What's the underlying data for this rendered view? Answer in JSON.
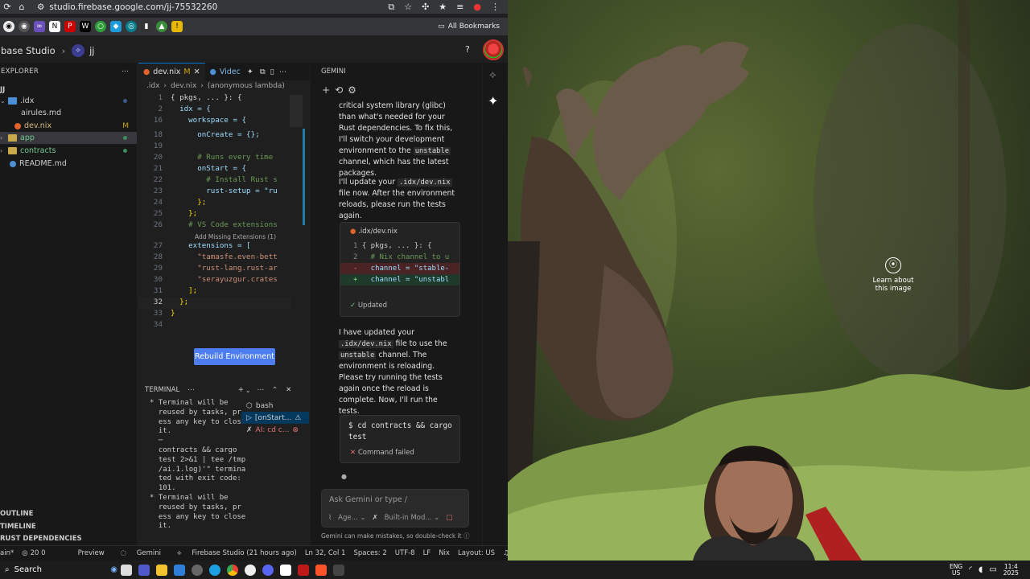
{
  "browser": {
    "url": "studio.firebase.google.com/jj-75532260",
    "all_bookmarks": "All Bookmarks"
  },
  "studio": {
    "brand": "base Studio",
    "project": "jj"
  },
  "explorer": {
    "title": "EXPLORER",
    "root": "JJ",
    "items": [
      {
        "label": ".idx",
        "kind": "folder-open"
      },
      {
        "label": "airules.md",
        "kind": "file"
      },
      {
        "label": "dev.nix",
        "kind": "file",
        "mark": "M"
      },
      {
        "label": "app",
        "kind": "folder"
      },
      {
        "label": "contracts",
        "kind": "folder"
      },
      {
        "label": "README.md",
        "kind": "file"
      }
    ],
    "sections": [
      "OUTLINE",
      "TIMELINE",
      "RUST DEPENDENCIES"
    ]
  },
  "editor": {
    "tabs": [
      {
        "label": "dev.nix",
        "mark": "M"
      },
      {
        "label": "Videc"
      }
    ],
    "breadcrumb": [
      ".idx",
      "dev.nix",
      "(anonymous lambda)"
    ],
    "lines": [
      {
        "n": "1",
        "text": "{ pkgs, ... }: {"
      },
      {
        "n": "2",
        "text": "  idx = {"
      },
      {
        "n": "16",
        "text": "    workspace = {"
      },
      {
        "n": "18",
        "text": "      onCreate = {};"
      },
      {
        "n": "19",
        "text": ""
      },
      {
        "n": "20",
        "text": "      # Runs every time"
      },
      {
        "n": "21",
        "text": "      onStart = {"
      },
      {
        "n": "22",
        "text": "        # Install Rust s"
      },
      {
        "n": "23",
        "text": "        rust-setup = \"ru"
      },
      {
        "n": "24",
        "text": "      };"
      },
      {
        "n": "25",
        "text": "    };"
      },
      {
        "n": "26",
        "text": "    # VS Code extensions"
      },
      {
        "n": "27",
        "text": "    extensions = ["
      },
      {
        "n": "28",
        "text": "      \"tamasfe.even-bett"
      },
      {
        "n": "29",
        "text": "      \"rust-lang.rust-ar"
      },
      {
        "n": "30",
        "text": "      \"serayuzgur.crates"
      },
      {
        "n": "31",
        "text": "    ];"
      },
      {
        "n": "32",
        "text": "  };"
      },
      {
        "n": "33",
        "text": "}"
      },
      {
        "n": "34",
        "text": ""
      }
    ],
    "codelens": "Add Missing Extensions (1)",
    "rebuild_button": "Rebuild Environment"
  },
  "terminal": {
    "title": "TERMINAL",
    "output": [
      "* Terminal will be",
      "  reused by tasks, pr",
      "  ess any key to close",
      "  it.",
      "",
      "  contracts && cargo",
      "  test 2>&1 | tee /tmp",
      "  /ai.1.log)'\" termina",
      "  ted with exit code:",
      "  101.",
      "* Terminal will be",
      "  reused by tasks, pr",
      "  ess any key to close",
      "  it."
    ],
    "sessions": [
      "bash",
      "[onStart...",
      "AI: cd c..."
    ]
  },
  "gemini": {
    "title": "GEMINI",
    "p1": "critical system library (glibc) than what's needed for your Rust dependencies. To fix this, I'll switch your development environment to the",
    "p1_code": "unstable",
    "p1_tail": "channel, which has the latest packages.",
    "p2_a": "I'll update your",
    "p2_code": ".idx/dev.nix",
    "p2_b": "file now. After the environment reloads, please run the tests again.",
    "diff_file": ".idx/dev.nix",
    "diff": [
      {
        "n": "1",
        "type": "ctx",
        "text": "{ pkgs, ... }: {"
      },
      {
        "n": "2",
        "type": "ctx",
        "text": "  # Nix channel to u"
      },
      {
        "n": "-",
        "type": "del",
        "text": "  channel = \"stable-"
      },
      {
        "n": "+",
        "type": "add",
        "text": "  channel = \"unstabl"
      }
    ],
    "diff_status": "Updated",
    "p3_a": "I have updated your",
    "p3_code1": ".idx/dev.nix",
    "p3_b": "file to use the",
    "p3_code2": "unstable",
    "p3_c": "channel. The environment is reloading. Please try running the tests again once the reload is complete. Now, I'll run the tests.",
    "cmd": "$ cd contracts && cargo test",
    "cmd_status": "Command failed",
    "input_placeholder": "Ask Gemini or type /",
    "agent_label": "Age...",
    "model_label": "Built-in Mod...",
    "disclaimer": "Gemini can make mistakes, so double-check it"
  },
  "statusbar": {
    "left": "ain*",
    "counts": "20  0",
    "preview": "Preview",
    "gemini": "Gemini",
    "studio": "Firebase Studio (21 hours ago)",
    "position": "Ln 32, Col 1",
    "spaces": "Spaces: 2",
    "encoding": "UTF-8",
    "eol": "LF",
    "lang": "Nix",
    "layout": "Layout: US"
  },
  "desktop": {
    "learn": "Learn about this image"
  },
  "taskbar": {
    "search": "Search",
    "lang": "ENG",
    "region": "US",
    "time": "11:4",
    "date": "2025"
  }
}
